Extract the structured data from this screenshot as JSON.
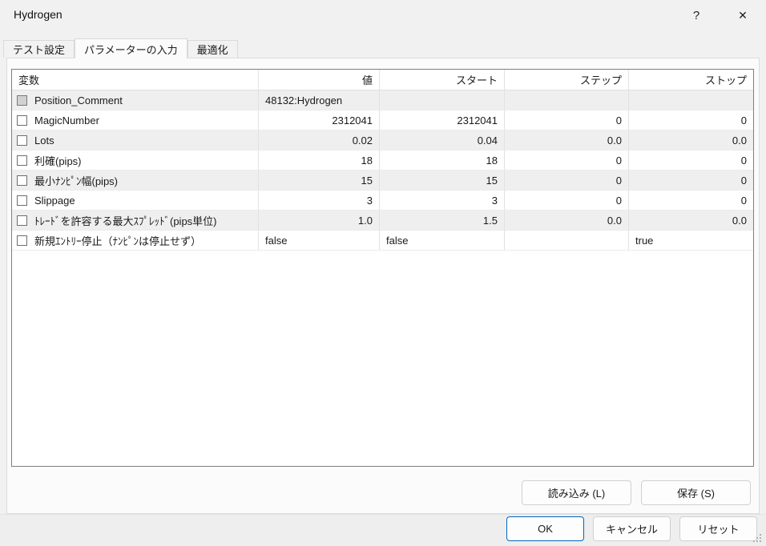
{
  "window": {
    "title": "Hydrogen",
    "help_icon": "?",
    "close_icon": "✕"
  },
  "tabs": [
    {
      "label": "テスト設定",
      "active": false
    },
    {
      "label": "パラメーターの入力",
      "active": true
    },
    {
      "label": "最適化",
      "active": false
    }
  ],
  "table": {
    "headers": {
      "variable": "変数",
      "value": "値",
      "start": "スタート",
      "step": "ステップ",
      "stop": "ストップ"
    },
    "rows": [
      {
        "variable": "Position_Comment",
        "value": "48132:Hydrogen",
        "start": "",
        "step": "",
        "stop": "",
        "checkbox_enabled": false,
        "checked": false
      },
      {
        "variable": "MagicNumber",
        "value": "2312041",
        "start": "2312041",
        "step": "0",
        "stop": "0",
        "checkbox_enabled": true,
        "checked": false
      },
      {
        "variable": "Lots",
        "value": "0.02",
        "start": "0.04",
        "step": "0.0",
        "stop": "0.0",
        "checkbox_enabled": true,
        "checked": false
      },
      {
        "variable": "利確(pips)",
        "value": "18",
        "start": "18",
        "step": "0",
        "stop": "0",
        "checkbox_enabled": true,
        "checked": false
      },
      {
        "variable": "最小ﾅﾝﾋﾟﾝ幅(pips)",
        "value": "15",
        "start": "15",
        "step": "0",
        "stop": "0",
        "checkbox_enabled": true,
        "checked": false
      },
      {
        "variable": "Slippage",
        "value": "3",
        "start": "3",
        "step": "0",
        "stop": "0",
        "checkbox_enabled": true,
        "checked": false
      },
      {
        "variable": "ﾄﾚｰﾄﾞを許容する最大ｽﾌﾟﾚｯﾄﾞ(pips単位)",
        "value": "1.0",
        "start": "1.5",
        "step": "0.0",
        "stop": "0.0",
        "checkbox_enabled": true,
        "checked": false
      },
      {
        "variable": "新規ｴﾝﾄﾘｰ停止（ﾅﾝﾋﾟﾝは停止せず）",
        "value": "false",
        "start": "false",
        "step": "",
        "stop": "true",
        "checkbox_enabled": true,
        "checked": false
      }
    ]
  },
  "buttons": {
    "load": "読み込み (L)",
    "save": "保存 (S)",
    "ok": "OK",
    "cancel": "キャンセル",
    "reset": "リセット"
  },
  "colors": {
    "accent": "#0067c0",
    "alt_row": "#efefef",
    "table_border": "#7e7e7e"
  }
}
